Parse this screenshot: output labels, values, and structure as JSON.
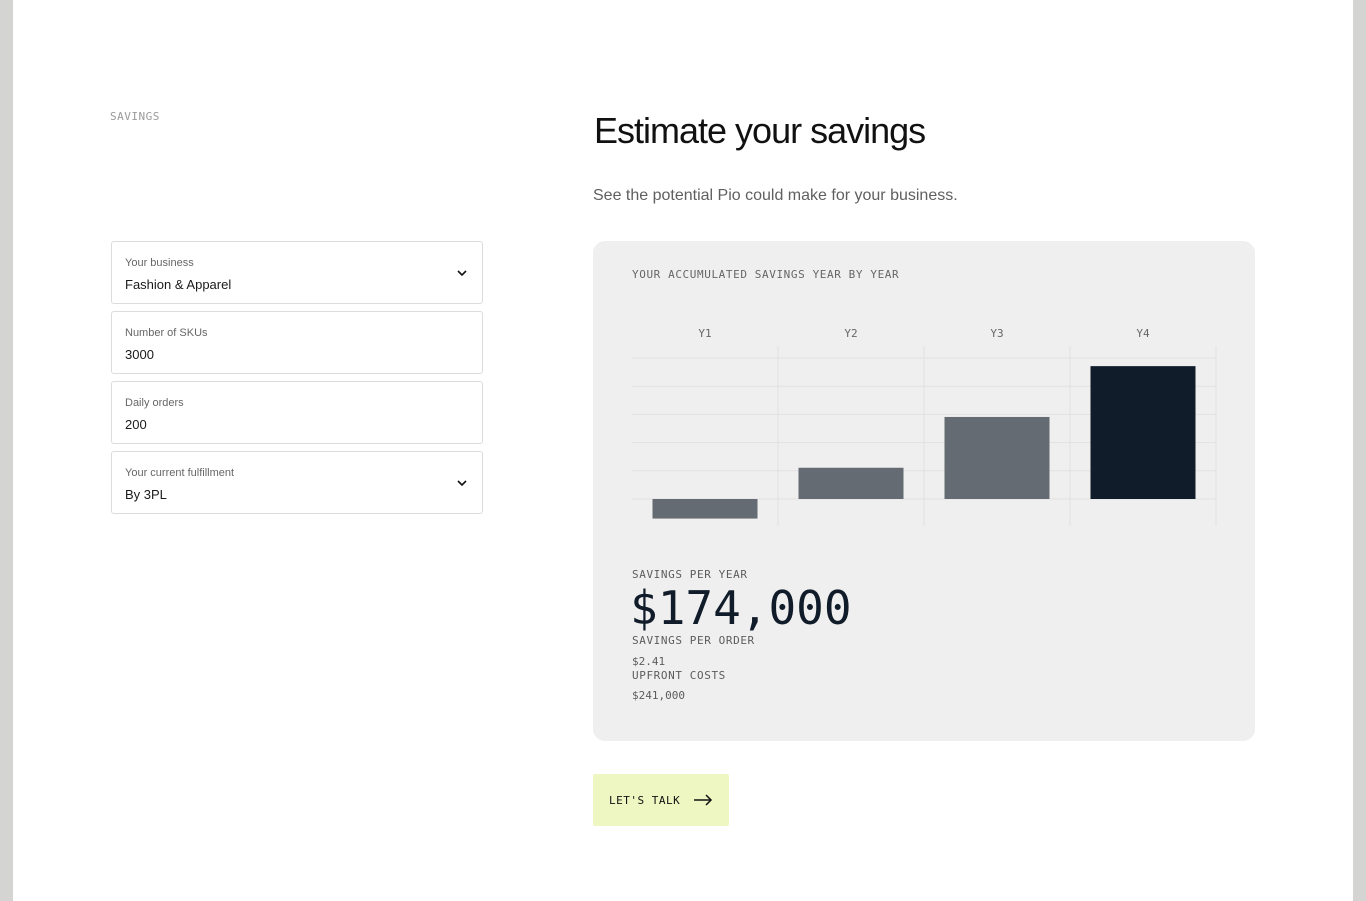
{
  "section_label": "SAVINGS",
  "heading": "Estimate your savings",
  "subtitle": "See the potential Pio could make for your business.",
  "form": {
    "business": {
      "label": "Your business",
      "value": "Fashion & Apparel",
      "icon": "chevron-down-icon"
    },
    "skus": {
      "label": "Number of SKUs",
      "value": "3000"
    },
    "daily_orders": {
      "label": "Daily orders",
      "value": "200"
    },
    "fulfillment": {
      "label": "Your current fulfillment",
      "value": "By 3PL",
      "icon": "chevron-down-icon"
    }
  },
  "chart_data": {
    "type": "bar",
    "title": "YOUR ACCUMULATED SAVINGS YEAR BY YEAR",
    "categories": [
      "Y1",
      "Y2",
      "Y3",
      "Y4"
    ],
    "values": [
      -67000,
      107000,
      281000,
      455000
    ],
    "ylim": [
      -90000,
      500000
    ],
    "grid": true,
    "colors": [
      "#656b72",
      "#656b72",
      "#656b72",
      "#111c2a"
    ]
  },
  "metrics": {
    "savings_per_year_label": "SAVINGS PER YEAR",
    "savings_per_year_value": "$174,000",
    "savings_per_order_label": "SAVINGS PER ORDER",
    "savings_per_order_value": "$2.41",
    "upfront_costs_label": "UPFRONT COSTS",
    "upfront_costs_value": "$241,000"
  },
  "cta": {
    "label": "LET'S TALK",
    "icon": "arrow-right-icon"
  },
  "colors": {
    "accent": "#eef7c2",
    "card_bg": "#f0efef",
    "dark_bar": "#111c2a",
    "mid_bar": "#656b72"
  }
}
